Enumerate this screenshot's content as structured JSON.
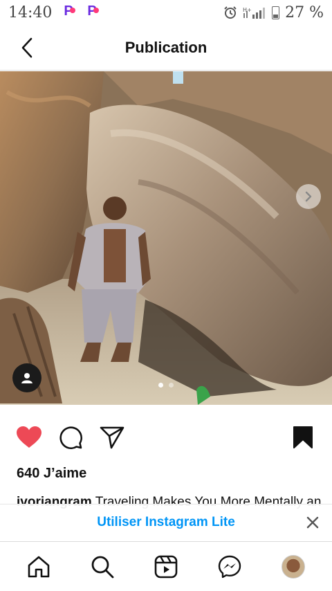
{
  "status_bar": {
    "time": "14:40",
    "battery": "27 %",
    "icons": [
      "app-icon",
      "app-icon",
      "alarm-icon",
      "signal-icon",
      "battery-icon"
    ]
  },
  "header": {
    "title": "Publication",
    "back_icon": "chevron-left-icon"
  },
  "post": {
    "image_icons": [
      "chevron-right-icon",
      "user-tag-icon"
    ],
    "carousel_pages": 2,
    "carousel_active": 0,
    "actions": {
      "like_icon": "heart-filled-icon",
      "comment_icon": "comment-icon",
      "share_icon": "send-icon",
      "save_icon": "bookmark-filled-icon"
    },
    "likes_text": "640 J’aime",
    "caption": {
      "username": "ivoriangram",
      "text": " Traveling Makes You More Mentally and"
    }
  },
  "banner": {
    "link_label": "Utiliser Instagram Lite",
    "close_icon": "close-icon"
  },
  "bottom_nav": {
    "items": [
      "home-icon",
      "search-icon",
      "reels-icon",
      "messenger-icon",
      "profile-avatar"
    ]
  },
  "colors": {
    "like_red": "#ed4956",
    "link_blue": "#0095f6",
    "text": "#111111",
    "divider": "#dbdbdb"
  }
}
